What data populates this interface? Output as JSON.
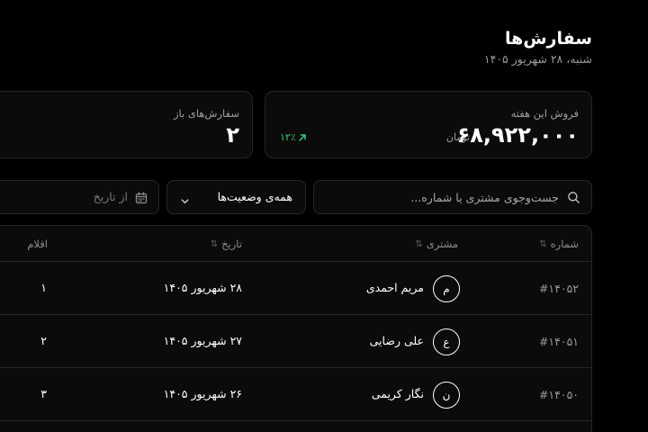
{
  "header": {
    "title": "سفارش‌ها",
    "date": "شنبه، ۲۸ شهریور ۱۴۰۵"
  },
  "stats": {
    "sales": {
      "label": "فروش این هفته",
      "value": "۶۸,۹۲۲,۰۰۰",
      "unit": "تومان",
      "trend": "۱۲٪"
    },
    "open": {
      "label": "سفارش‌های باز",
      "value": "۲"
    }
  },
  "filters": {
    "search_placeholder": "جست‌وجوی مشتری یا شماره...",
    "status_label": "همه‌ی وضعیت‌ها",
    "date_from": "از تاریخ"
  },
  "table": {
    "columns": {
      "number": "شماره",
      "customer": "مشتری",
      "date": "تاریخ",
      "items": "اقلام"
    },
    "rows": [
      {
        "number": "#۱۴۰۵۲",
        "initial": "م",
        "customer": "مریم احمدی",
        "date": "۲۸ شهریور ۱۴۰۵",
        "items": "۱"
      },
      {
        "number": "#۱۴۰۵۱",
        "initial": "ع",
        "customer": "علی رضایی",
        "date": "۲۷ شهریور ۱۴۰۵",
        "items": "۲"
      },
      {
        "number": "#۱۴۰۵۰",
        "initial": "ن",
        "customer": "نگار کریمی",
        "date": "۲۶ شهریور ۱۴۰۵",
        "items": "۳"
      }
    ]
  },
  "colors": {
    "background": "#000000",
    "card": "#0b0b0b",
    "border": "#262626",
    "trend_positive": "#34d07a"
  },
  "icons": {
    "search": "search-icon",
    "chevron": "chevron-down-icon",
    "calendar": "calendar-icon",
    "sort": "sort-icon",
    "trend": "arrow-up-right-icon"
  }
}
